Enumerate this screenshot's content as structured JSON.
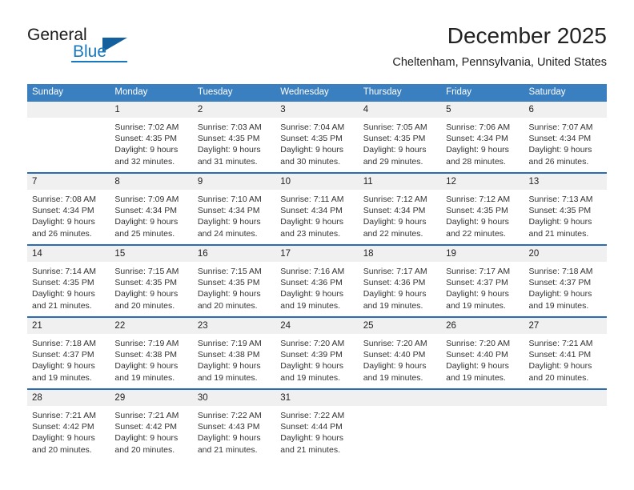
{
  "logo": {
    "word_one": "General",
    "word_two": "Blue",
    "mark": "triangle-mark"
  },
  "header": {
    "month_title": "December 2025",
    "location": "Cheltenham, Pennsylvania, United States"
  },
  "calendar": {
    "weekday_headers": [
      "Sunday",
      "Monday",
      "Tuesday",
      "Wednesday",
      "Thursday",
      "Friday",
      "Saturday"
    ],
    "labels": {
      "sunrise_prefix": "Sunrise:",
      "sunset_prefix": "Sunset:",
      "daylight_prefix": "Daylight:"
    },
    "weeks": [
      [
        {
          "day": "",
          "sunrise": "",
          "sunset": "",
          "daylight_line1": "",
          "daylight_line2": ""
        },
        {
          "day": "1",
          "sunrise": "Sunrise: 7:02 AM",
          "sunset": "Sunset: 4:35 PM",
          "daylight_line1": "Daylight: 9 hours",
          "daylight_line2": "and 32 minutes."
        },
        {
          "day": "2",
          "sunrise": "Sunrise: 7:03 AM",
          "sunset": "Sunset: 4:35 PM",
          "daylight_line1": "Daylight: 9 hours",
          "daylight_line2": "and 31 minutes."
        },
        {
          "day": "3",
          "sunrise": "Sunrise: 7:04 AM",
          "sunset": "Sunset: 4:35 PM",
          "daylight_line1": "Daylight: 9 hours",
          "daylight_line2": "and 30 minutes."
        },
        {
          "day": "4",
          "sunrise": "Sunrise: 7:05 AM",
          "sunset": "Sunset: 4:35 PM",
          "daylight_line1": "Daylight: 9 hours",
          "daylight_line2": "and 29 minutes."
        },
        {
          "day": "5",
          "sunrise": "Sunrise: 7:06 AM",
          "sunset": "Sunset: 4:34 PM",
          "daylight_line1": "Daylight: 9 hours",
          "daylight_line2": "and 28 minutes."
        },
        {
          "day": "6",
          "sunrise": "Sunrise: 7:07 AM",
          "sunset": "Sunset: 4:34 PM",
          "daylight_line1": "Daylight: 9 hours",
          "daylight_line2": "and 26 minutes."
        }
      ],
      [
        {
          "day": "7",
          "sunrise": "Sunrise: 7:08 AM",
          "sunset": "Sunset: 4:34 PM",
          "daylight_line1": "Daylight: 9 hours",
          "daylight_line2": "and 26 minutes."
        },
        {
          "day": "8",
          "sunrise": "Sunrise: 7:09 AM",
          "sunset": "Sunset: 4:34 PM",
          "daylight_line1": "Daylight: 9 hours",
          "daylight_line2": "and 25 minutes."
        },
        {
          "day": "9",
          "sunrise": "Sunrise: 7:10 AM",
          "sunset": "Sunset: 4:34 PM",
          "daylight_line1": "Daylight: 9 hours",
          "daylight_line2": "and 24 minutes."
        },
        {
          "day": "10",
          "sunrise": "Sunrise: 7:11 AM",
          "sunset": "Sunset: 4:34 PM",
          "daylight_line1": "Daylight: 9 hours",
          "daylight_line2": "and 23 minutes."
        },
        {
          "day": "11",
          "sunrise": "Sunrise: 7:12 AM",
          "sunset": "Sunset: 4:34 PM",
          "daylight_line1": "Daylight: 9 hours",
          "daylight_line2": "and 22 minutes."
        },
        {
          "day": "12",
          "sunrise": "Sunrise: 7:12 AM",
          "sunset": "Sunset: 4:35 PM",
          "daylight_line1": "Daylight: 9 hours",
          "daylight_line2": "and 22 minutes."
        },
        {
          "day": "13",
          "sunrise": "Sunrise: 7:13 AM",
          "sunset": "Sunset: 4:35 PM",
          "daylight_line1": "Daylight: 9 hours",
          "daylight_line2": "and 21 minutes."
        }
      ],
      [
        {
          "day": "14",
          "sunrise": "Sunrise: 7:14 AM",
          "sunset": "Sunset: 4:35 PM",
          "daylight_line1": "Daylight: 9 hours",
          "daylight_line2": "and 21 minutes."
        },
        {
          "day": "15",
          "sunrise": "Sunrise: 7:15 AM",
          "sunset": "Sunset: 4:35 PM",
          "daylight_line1": "Daylight: 9 hours",
          "daylight_line2": "and 20 minutes."
        },
        {
          "day": "16",
          "sunrise": "Sunrise: 7:15 AM",
          "sunset": "Sunset: 4:35 PM",
          "daylight_line1": "Daylight: 9 hours",
          "daylight_line2": "and 20 minutes."
        },
        {
          "day": "17",
          "sunrise": "Sunrise: 7:16 AM",
          "sunset": "Sunset: 4:36 PM",
          "daylight_line1": "Daylight: 9 hours",
          "daylight_line2": "and 19 minutes."
        },
        {
          "day": "18",
          "sunrise": "Sunrise: 7:17 AM",
          "sunset": "Sunset: 4:36 PM",
          "daylight_line1": "Daylight: 9 hours",
          "daylight_line2": "and 19 minutes."
        },
        {
          "day": "19",
          "sunrise": "Sunrise: 7:17 AM",
          "sunset": "Sunset: 4:37 PM",
          "daylight_line1": "Daylight: 9 hours",
          "daylight_line2": "and 19 minutes."
        },
        {
          "day": "20",
          "sunrise": "Sunrise: 7:18 AM",
          "sunset": "Sunset: 4:37 PM",
          "daylight_line1": "Daylight: 9 hours",
          "daylight_line2": "and 19 minutes."
        }
      ],
      [
        {
          "day": "21",
          "sunrise": "Sunrise: 7:18 AM",
          "sunset": "Sunset: 4:37 PM",
          "daylight_line1": "Daylight: 9 hours",
          "daylight_line2": "and 19 minutes."
        },
        {
          "day": "22",
          "sunrise": "Sunrise: 7:19 AM",
          "sunset": "Sunset: 4:38 PM",
          "daylight_line1": "Daylight: 9 hours",
          "daylight_line2": "and 19 minutes."
        },
        {
          "day": "23",
          "sunrise": "Sunrise: 7:19 AM",
          "sunset": "Sunset: 4:38 PM",
          "daylight_line1": "Daylight: 9 hours",
          "daylight_line2": "and 19 minutes."
        },
        {
          "day": "24",
          "sunrise": "Sunrise: 7:20 AM",
          "sunset": "Sunset: 4:39 PM",
          "daylight_line1": "Daylight: 9 hours",
          "daylight_line2": "and 19 minutes."
        },
        {
          "day": "25",
          "sunrise": "Sunrise: 7:20 AM",
          "sunset": "Sunset: 4:40 PM",
          "daylight_line1": "Daylight: 9 hours",
          "daylight_line2": "and 19 minutes."
        },
        {
          "day": "26",
          "sunrise": "Sunrise: 7:20 AM",
          "sunset": "Sunset: 4:40 PM",
          "daylight_line1": "Daylight: 9 hours",
          "daylight_line2": "and 19 minutes."
        },
        {
          "day": "27",
          "sunrise": "Sunrise: 7:21 AM",
          "sunset": "Sunset: 4:41 PM",
          "daylight_line1": "Daylight: 9 hours",
          "daylight_line2": "and 20 minutes."
        }
      ],
      [
        {
          "day": "28",
          "sunrise": "Sunrise: 7:21 AM",
          "sunset": "Sunset: 4:42 PM",
          "daylight_line1": "Daylight: 9 hours",
          "daylight_line2": "and 20 minutes."
        },
        {
          "day": "29",
          "sunrise": "Sunrise: 7:21 AM",
          "sunset": "Sunset: 4:42 PM",
          "daylight_line1": "Daylight: 9 hours",
          "daylight_line2": "and 20 minutes."
        },
        {
          "day": "30",
          "sunrise": "Sunrise: 7:22 AM",
          "sunset": "Sunset: 4:43 PM",
          "daylight_line1": "Daylight: 9 hours",
          "daylight_line2": "and 21 minutes."
        },
        {
          "day": "31",
          "sunrise": "Sunrise: 7:22 AM",
          "sunset": "Sunset: 4:44 PM",
          "daylight_line1": "Daylight: 9 hours",
          "daylight_line2": "and 21 minutes."
        },
        {
          "day": "",
          "sunrise": "",
          "sunset": "",
          "daylight_line1": "",
          "daylight_line2": ""
        },
        {
          "day": "",
          "sunrise": "",
          "sunset": "",
          "daylight_line1": "",
          "daylight_line2": ""
        },
        {
          "day": "",
          "sunrise": "",
          "sunset": "",
          "daylight_line1": "",
          "daylight_line2": ""
        }
      ]
    ]
  },
  "colors": {
    "header_blue": "#3a7fbf",
    "rule_blue": "#2a6db5",
    "daynum_band": "#f0f0f0",
    "logo_blue": "#1878be",
    "logo_triangle": "#14609e"
  }
}
